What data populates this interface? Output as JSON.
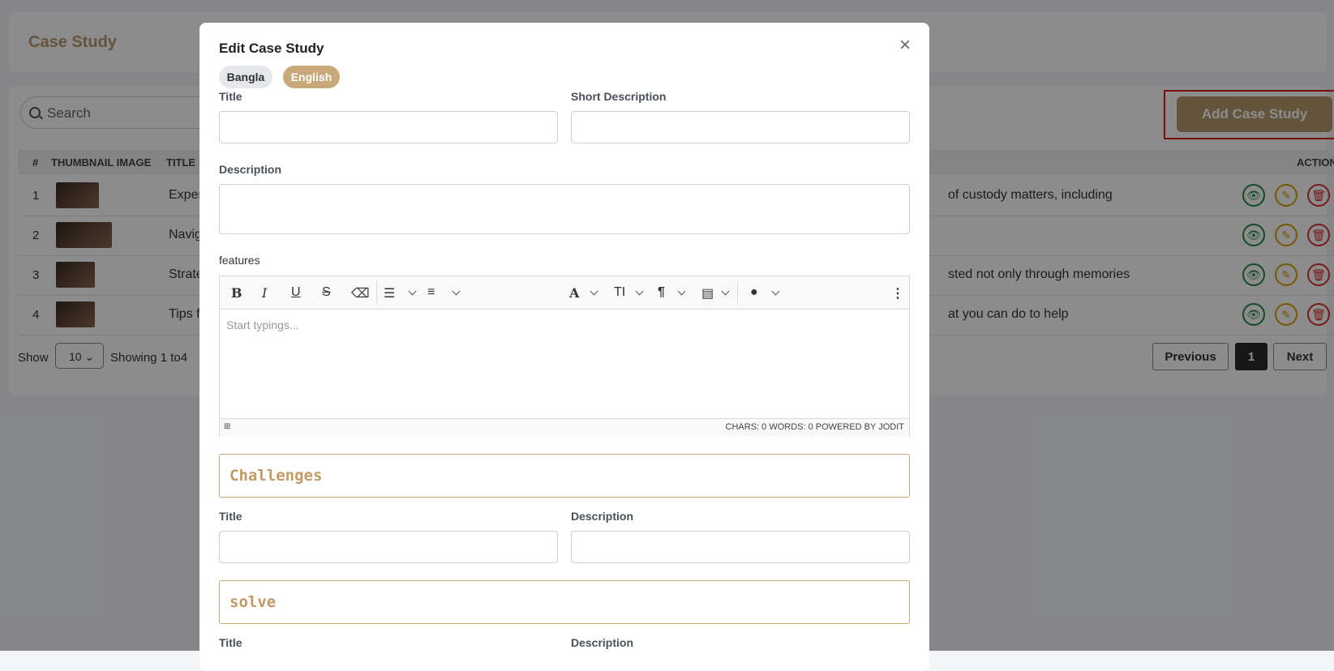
{
  "page": {
    "title": "Case Study",
    "search_placeholder": "Search",
    "add_button": "Add Case Study",
    "table": {
      "headers": [
        "#",
        "THUMBNAIL IMAGE",
        "TITLE",
        "ACTION"
      ],
      "rows": [
        {
          "num": "1",
          "title": "Experie",
          "desc": "of custody matters, including"
        },
        {
          "num": "2",
          "title": "Navigat",
          "desc": ""
        },
        {
          "num": "3",
          "title": "Strateg",
          "desc": "sted not only through memories"
        },
        {
          "num": "4",
          "title": "Tips fro",
          "desc": "at you can do to help"
        }
      ]
    },
    "footer": {
      "show_label": "Show",
      "page_size": "10",
      "showing": "Showing 1  to4",
      "prev": "Previous",
      "page": "1",
      "next": "Next"
    }
  },
  "modal": {
    "title": "Edit Case Study",
    "close": "×",
    "lang_tabs": [
      "Bangla",
      "English"
    ],
    "active_lang": "English",
    "labels": {
      "title": "Title",
      "short_description": "Short Description",
      "description": "Description",
      "features": "features"
    },
    "editor": {
      "placeholder": "Start typings...",
      "status": "CHARS: 0   WORDS: 0   POWERED BY JODIT"
    },
    "challenges": {
      "heading": "Challenges",
      "title_label": "Title",
      "description_label": "Description"
    },
    "solve": {
      "heading": "solve",
      "title_label": "Title",
      "description_label": "Description"
    }
  },
  "colors": {
    "accent": "#b89a6e",
    "section_border": "#c9a87a",
    "highlight": "#e21b1b"
  }
}
